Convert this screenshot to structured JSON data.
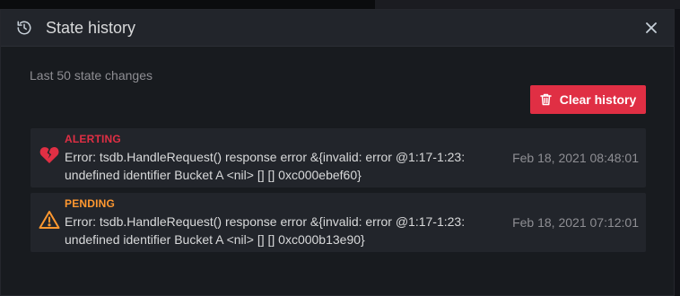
{
  "modal": {
    "title": "State history",
    "close_icon": "close-icon",
    "header_icon": "history-icon"
  },
  "subtitle": "Last 50 state changes",
  "clear_button": {
    "label": "Clear history",
    "icon": "trash-icon",
    "color": "#e02f44"
  },
  "items": [
    {
      "state": "ALERTING",
      "icon": "heart-break-icon",
      "color": "#e02f44",
      "message": "Error: tsdb.HandleRequest() response error &{invalid: error @1:17-1:23: undefined identifier Bucket A <nil> [] [] 0xc000ebef60}",
      "timestamp": "Feb 18, 2021 08:48:01"
    },
    {
      "state": "PENDING",
      "icon": "warning-triangle-icon",
      "color": "#ff9830",
      "message": "Error: tsdb.HandleRequest() response error &{invalid: error @1:17-1:23: undefined identifier Bucket A <nil> [] [] 0xc000b13e90}",
      "timestamp": "Feb 18, 2021 07:12:01"
    }
  ]
}
